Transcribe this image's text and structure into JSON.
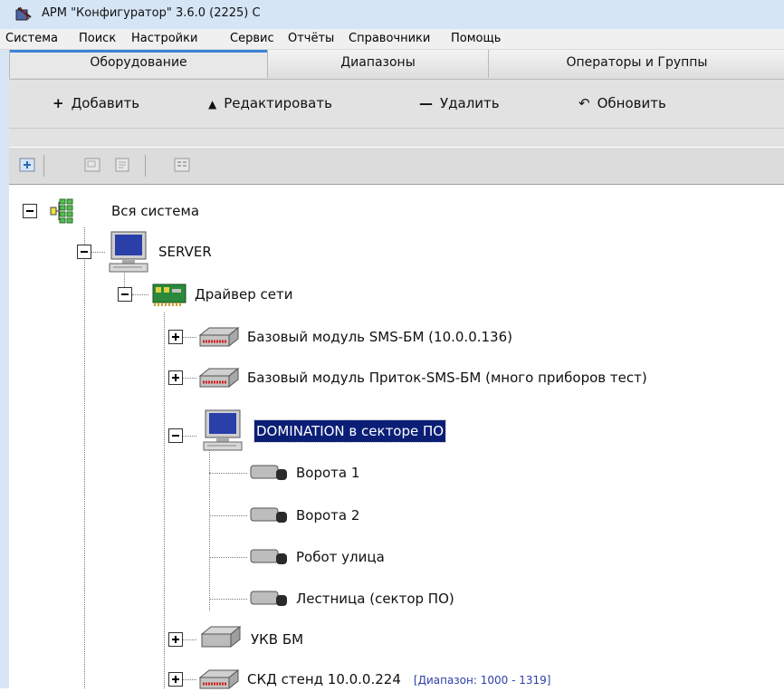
{
  "window": {
    "title": "АРМ \"Конфигуратор\"  3.6.0 (2225) С"
  },
  "menu": [
    "Система",
    "Поиск",
    "Настройки",
    "Сервис",
    "Отчёты",
    "Справочники",
    "Помощь"
  ],
  "tabs": [
    {
      "label": "Оборудование",
      "active": true
    },
    {
      "label": "Диапазоны",
      "active": false
    },
    {
      "label": "Операторы и Группы",
      "active": false
    }
  ],
  "toolbar": {
    "add_label": "Добавить",
    "edit_label": "Редактировать",
    "delete_label": "Удалить",
    "refresh_label": "Обновить"
  },
  "tree": {
    "root": "Вся система",
    "server": "SERVER",
    "driver": "Драйвер сети",
    "module1": "Базовый модуль SMS-БМ (10.0.0.136)",
    "module2": "Базовый модуль Приток-SMS-БМ (много приборов тест)",
    "domination": "DOMINATION в секторе ПО",
    "cameras": [
      "Ворота 1",
      "Ворота 2",
      "Робот улица",
      "Лестница (сектор ПО)"
    ],
    "ukv": "УКВ БМ",
    "skd": "СКД стенд 10.0.0.224",
    "skd_range": "[Диапазон: 1000 - 1319]"
  },
  "colors": {
    "selection": "#0a1e76",
    "tab_accent": "#3c82d6",
    "range_text": "#2c3fa6"
  }
}
